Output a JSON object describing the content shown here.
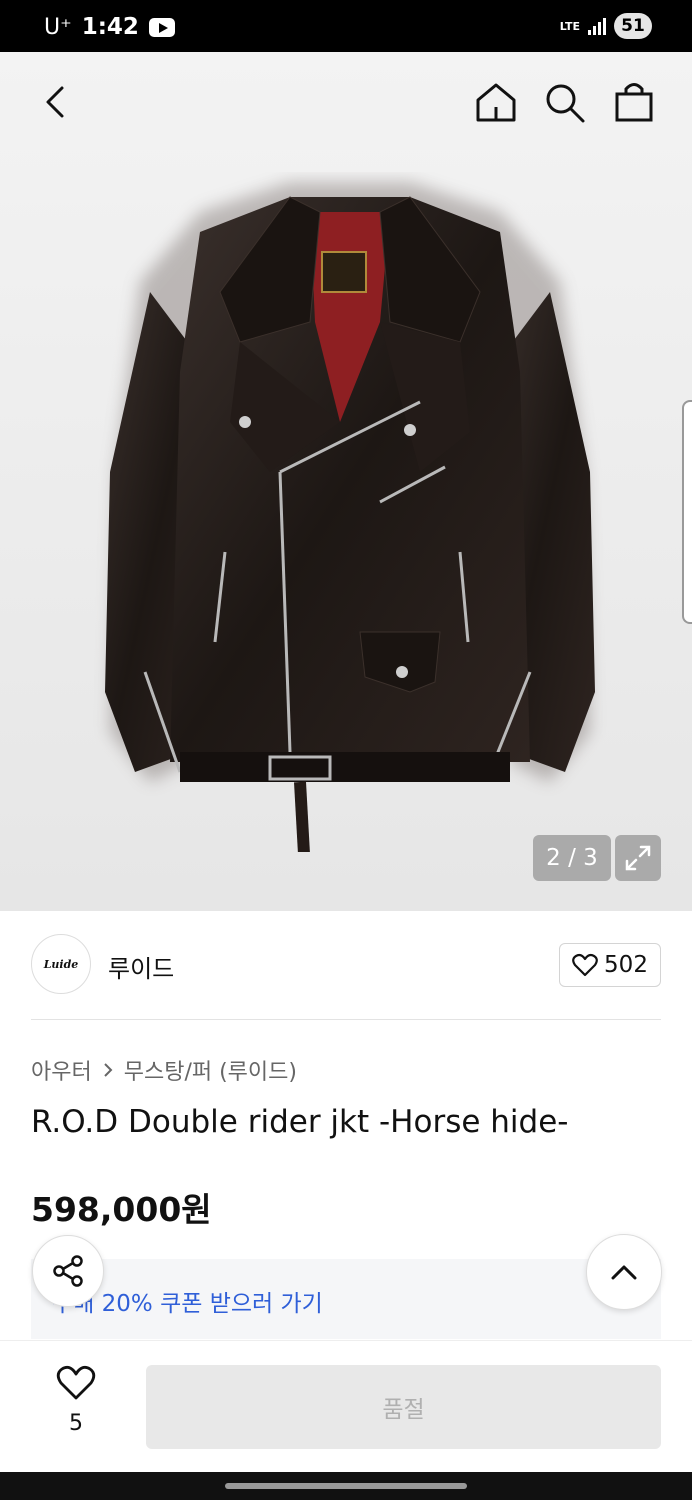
{
  "status_bar": {
    "carrier": "U⁺",
    "time": "1:42",
    "network": "LTE",
    "battery": "51"
  },
  "gallery": {
    "counter": "2 / 3"
  },
  "brand": {
    "logo_text": "Luide",
    "name": "루이드",
    "like_count": "502"
  },
  "breadcrumb": {
    "category": "아우터",
    "subcategory": "무스탕/퍼 (루이드)"
  },
  "product": {
    "title": "R.O.D Double rider jkt -Horse hide-",
    "price": "598,000원"
  },
  "coupon": {
    "text": "구매 20% 쿠폰 받으러 가기"
  },
  "bottom": {
    "wish_count": "5",
    "soldout_label": "품절"
  },
  "colors": {
    "accent": "#2f5fd8",
    "soldout_bg": "#e8e8e8"
  }
}
